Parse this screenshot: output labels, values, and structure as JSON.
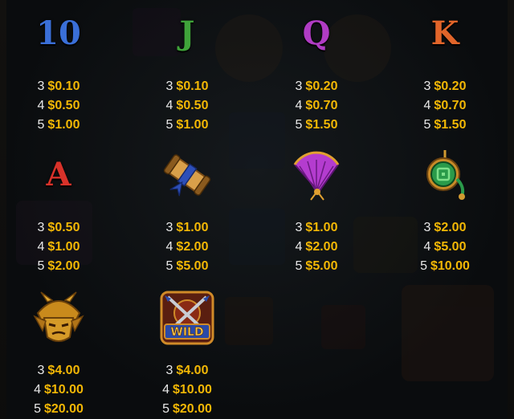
{
  "paytable": {
    "symbols": [
      {
        "id": "ten",
        "symbol_text": "10",
        "symbol_color": "#3a6fd8",
        "pays": [
          {
            "count": "3",
            "amount": "$0.10"
          },
          {
            "count": "4",
            "amount": "$0.50"
          },
          {
            "count": "5",
            "amount": "$1.00"
          }
        ]
      },
      {
        "id": "jack",
        "symbol_text": "J",
        "symbol_color": "#3fa33a",
        "pays": [
          {
            "count": "3",
            "amount": "$0.10"
          },
          {
            "count": "4",
            "amount": "$0.50"
          },
          {
            "count": "5",
            "amount": "$1.00"
          }
        ]
      },
      {
        "id": "queen",
        "symbol_text": "Q",
        "symbol_color": "#b03cc4",
        "pays": [
          {
            "count": "3",
            "amount": "$0.20"
          },
          {
            "count": "4",
            "amount": "$0.70"
          },
          {
            "count": "5",
            "amount": "$1.50"
          }
        ]
      },
      {
        "id": "king",
        "symbol_text": "K",
        "symbol_color": "#e2652a",
        "pays": [
          {
            "count": "3",
            "amount": "$0.20"
          },
          {
            "count": "4",
            "amount": "$0.70"
          },
          {
            "count": "5",
            "amount": "$1.50"
          }
        ]
      },
      {
        "id": "ace",
        "symbol_text": "A",
        "symbol_color": "#d8322a",
        "pays": [
          {
            "count": "3",
            "amount": "$0.50"
          },
          {
            "count": "4",
            "amount": "$1.00"
          },
          {
            "count": "5",
            "amount": "$2.00"
          }
        ]
      },
      {
        "id": "scroll",
        "icon": "scroll-icon",
        "pays": [
          {
            "count": "3",
            "amount": "$1.00"
          },
          {
            "count": "4",
            "amount": "$2.00"
          },
          {
            "count": "5",
            "amount": "$5.00"
          }
        ]
      },
      {
        "id": "fan",
        "icon": "fan-icon",
        "pays": [
          {
            "count": "3",
            "amount": "$1.00"
          },
          {
            "count": "4",
            "amount": "$2.00"
          },
          {
            "count": "5",
            "amount": "$5.00"
          }
        ]
      },
      {
        "id": "jade-amulet",
        "icon": "jade-amulet-icon",
        "pays": [
          {
            "count": "3",
            "amount": "$2.00"
          },
          {
            "count": "4",
            "amount": "$5.00"
          },
          {
            "count": "5",
            "amount": "$10.00"
          }
        ]
      },
      {
        "id": "samurai-helmet",
        "icon": "samurai-helmet-icon",
        "pays": [
          {
            "count": "3",
            "amount": "$4.00"
          },
          {
            "count": "4",
            "amount": "$10.00"
          },
          {
            "count": "5",
            "amount": "$20.00"
          }
        ]
      },
      {
        "id": "wild",
        "icon": "wild-swords-icon",
        "symbol_text": "WILD",
        "pays": [
          {
            "count": "3",
            "amount": "$4.00"
          },
          {
            "count": "4",
            "amount": "$10.00"
          },
          {
            "count": "5",
            "amount": "$20.00"
          }
        ]
      }
    ]
  },
  "colors": {
    "count_text": "#e8e8e8",
    "amount_text": "#f2b705",
    "background": "#0b0d0f"
  }
}
